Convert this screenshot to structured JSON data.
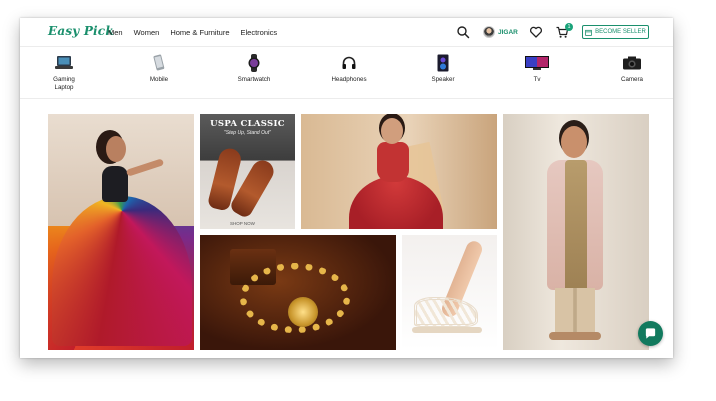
{
  "header": {
    "logo": "Easy Pick",
    "nav": [
      "Men",
      "Women",
      "Home & Furniture",
      "Electronics"
    ],
    "user_name": "JIGAR",
    "cart_count": "1",
    "seller_button": "BECOME SELLER"
  },
  "categories": [
    {
      "label": "Gaming\nLaptop",
      "icon": "laptop-icon"
    },
    {
      "label": "Mobile",
      "icon": "mobile-icon"
    },
    {
      "label": "Smartwatch",
      "icon": "smartwatch-icon"
    },
    {
      "label": "Headphones",
      "icon": "headphones-icon"
    },
    {
      "label": "Speaker",
      "icon": "speaker-icon"
    },
    {
      "label": "Tv",
      "icon": "tv-icon"
    },
    {
      "label": "Camera",
      "icon": "camera-icon"
    }
  ],
  "banners": {
    "uspa_title": "USPA CLASSIC",
    "uspa_tagline": "\"Step Up, Stand Out\"",
    "uspa_cta": "SHOP NOW"
  },
  "colors": {
    "brand": "#1a8f6c",
    "chat": "#127a5e"
  }
}
